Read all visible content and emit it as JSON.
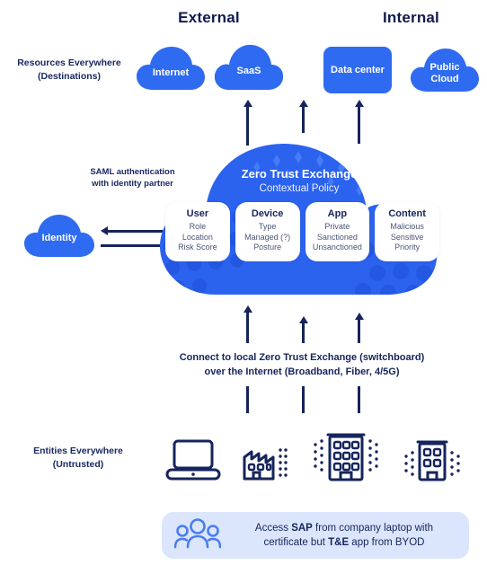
{
  "headings": {
    "external": "External",
    "internal": "Internal"
  },
  "rows": {
    "resources_label_line1": "Resources Everywhere",
    "resources_label_line2": "(Destinations)",
    "entities_label_line1": "Entities Everywhere",
    "entities_label_line2": "(Untrusted)"
  },
  "destinations": [
    {
      "name": "Internet",
      "shape": "cloud"
    },
    {
      "name": "SaaS",
      "shape": "cloud"
    },
    {
      "name": "Data center",
      "shape": "box"
    },
    {
      "name": "Public Cloud",
      "shape": "cloud",
      "line1": "Public",
      "line2": "Cloud"
    }
  ],
  "identity": {
    "note_line1": "SAML authentication",
    "note_line2": "with identity partner",
    "cloud_label": "Identity"
  },
  "exchange": {
    "title": "Zero Trust Exchange",
    "subtitle": "Contextual Policy"
  },
  "pillars": [
    {
      "title": "User",
      "items": [
        "Role",
        "Location",
        "Risk Score"
      ]
    },
    {
      "title": "Device",
      "items": [
        "Type",
        "Managed (?)",
        "Posture"
      ]
    },
    {
      "title": "App",
      "items": [
        "Private",
        "Sanctioned",
        "Unsanctioned"
      ]
    },
    {
      "title": "Content",
      "items": [
        "Malicious",
        "Sensitive",
        "Priority"
      ]
    }
  ],
  "connect": {
    "line1": "Connect to local Zero Trust Exchange (switchboard)",
    "line2": "over the Internet (Broadband, Fiber, 4/5G)"
  },
  "entities": [
    {
      "icon": "laptop-icon"
    },
    {
      "icon": "factory-icon"
    },
    {
      "icon": "office-building-large-icon"
    },
    {
      "icon": "office-building-small-icon"
    }
  ],
  "callout": {
    "icon": "people-group-icon",
    "part1": "Access ",
    "bold1": "SAP",
    "part2": " from company laptop with",
    "part3": "certificate but ",
    "bold2": "T&E",
    "part4": " app from BYOD"
  },
  "colors": {
    "brand_blue": "#2f6bf0",
    "cloud_blue": "#2b63ef",
    "cloud_light": "#3d79f5",
    "navy": "#16245c",
    "banner_bg": "#dbe6fc",
    "white": "#ffffff"
  }
}
